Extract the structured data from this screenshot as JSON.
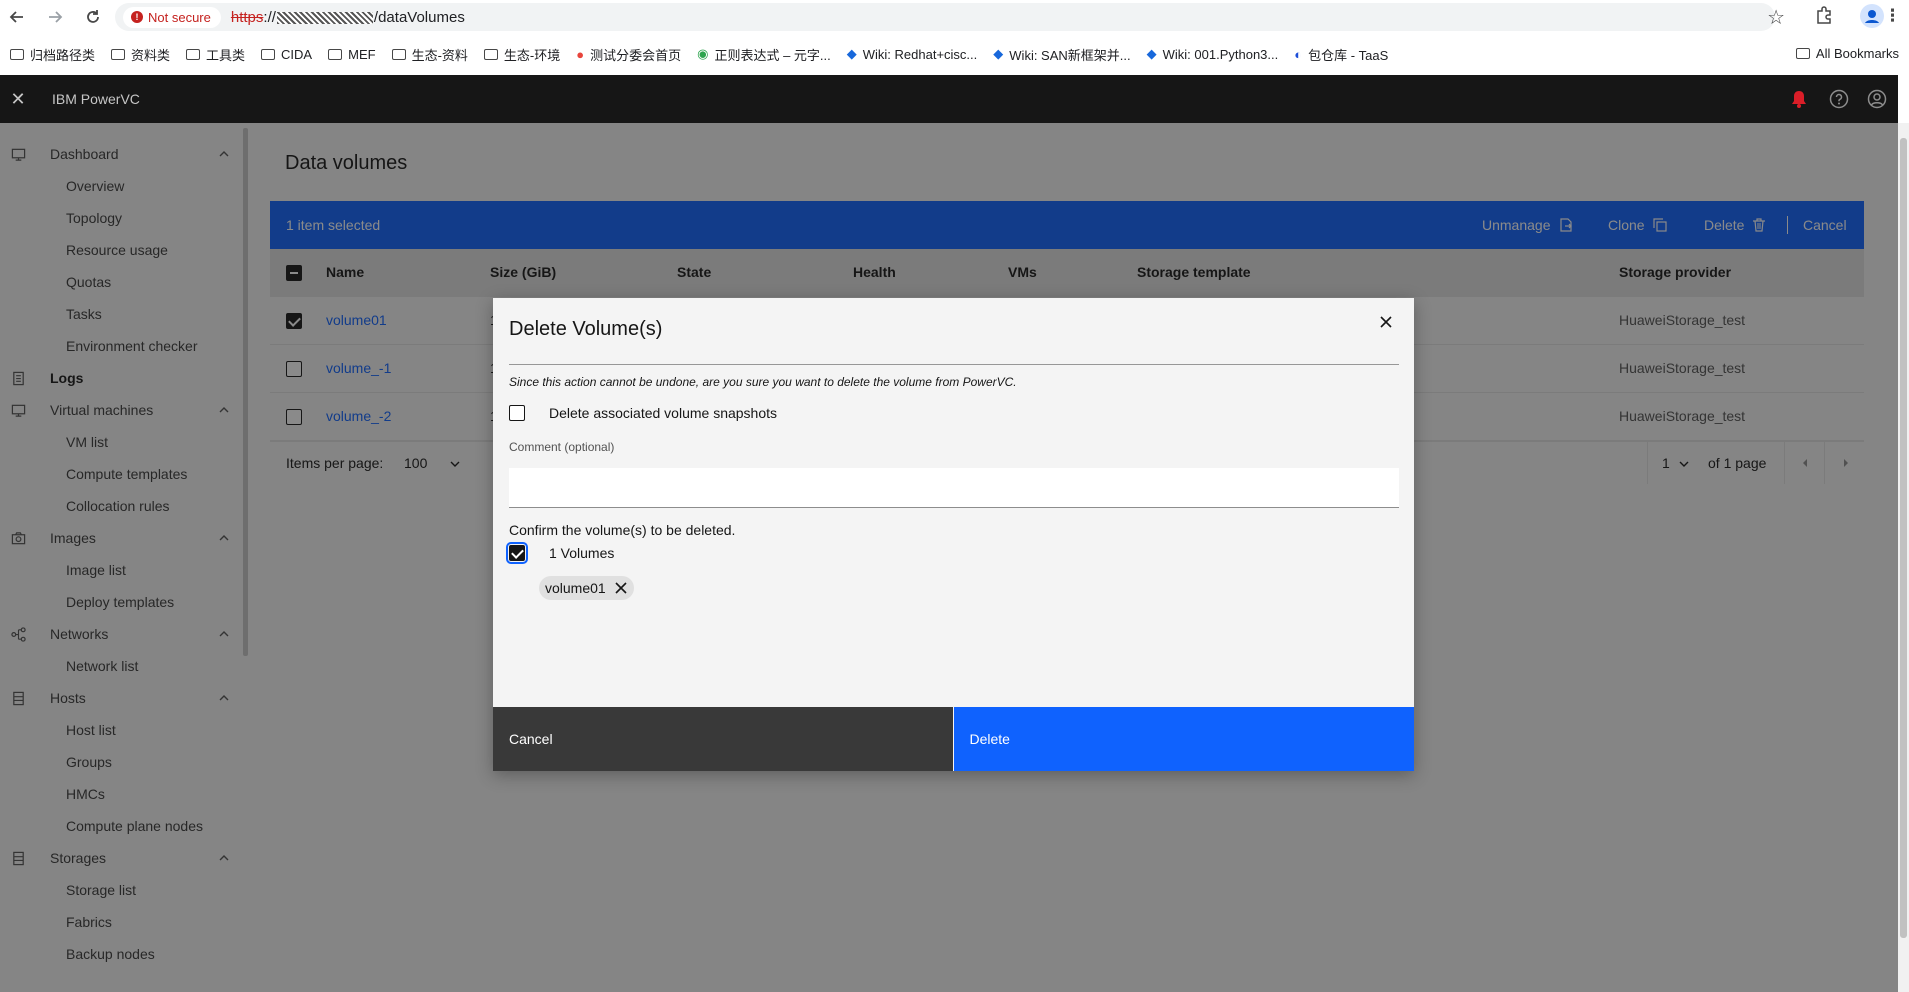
{
  "browser": {
    "security_label": "Not secure",
    "url_proto": "https",
    "url_sep": "://",
    "url_path": "/dataVolumes",
    "bookmarks": [
      "归档路径类",
      "资料类",
      "工具类",
      "CIDA",
      "MEF",
      "生态-资料",
      "生态-环境",
      "测试分委会首页",
      "正则表达式 – 元字...",
      "Wiki: Redhat+cisc...",
      "Wiki: SAN新框架并...",
      "Wiki: 001.Python3...",
      "包仓库 - TaaS"
    ],
    "all_bookmarks": "All Bookmarks"
  },
  "app": {
    "title": "IBM PowerVC"
  },
  "sidebar": {
    "items": [
      {
        "label": "Dashboard"
      },
      {
        "label": "Overview"
      },
      {
        "label": "Topology"
      },
      {
        "label": "Resource usage"
      },
      {
        "label": "Quotas"
      },
      {
        "label": "Tasks"
      },
      {
        "label": "Environment checker"
      },
      {
        "label": "Logs"
      },
      {
        "label": "Virtual machines"
      },
      {
        "label": "VM list"
      },
      {
        "label": "Compute templates"
      },
      {
        "label": "Collocation rules"
      },
      {
        "label": "Images"
      },
      {
        "label": "Image list"
      },
      {
        "label": "Deploy templates"
      },
      {
        "label": "Networks"
      },
      {
        "label": "Network list"
      },
      {
        "label": "Hosts"
      },
      {
        "label": "Host list"
      },
      {
        "label": "Groups"
      },
      {
        "label": "HMCs"
      },
      {
        "label": "Compute plane nodes"
      },
      {
        "label": "Storages"
      },
      {
        "label": "Storage list"
      },
      {
        "label": "Fabrics"
      },
      {
        "label": "Backup nodes"
      }
    ]
  },
  "page": {
    "title": "Data volumes",
    "selection": "1 item selected",
    "actions": {
      "unmanage": "Unmanage",
      "clone": "Clone",
      "delete": "Delete",
      "cancel": "Cancel"
    }
  },
  "table": {
    "headers": {
      "name": "Name",
      "size": "Size (GiB)",
      "state": "State",
      "health": "Health",
      "vms": "VMs",
      "template": "Storage template",
      "provider": "Storage provider"
    },
    "rows": [
      {
        "name": "volume01",
        "size": "1",
        "provider": "HuaweiStorage_test",
        "checked": true
      },
      {
        "name": "volume_-1",
        "size": "1",
        "provider": "HuaweiStorage_test",
        "checked": false
      },
      {
        "name": "volume_-2",
        "size": "1",
        "provider": "HuaweiStorage_test",
        "checked": false
      }
    ],
    "pager": {
      "items_label": "Items per page:",
      "per_page": "100",
      "page": "1",
      "of_pages": "of 1 page"
    }
  },
  "modal": {
    "title": "Delete Volume(s)",
    "warning": "Since this action cannot be undone, are you sure you want to delete the volume from PowerVC.",
    "snapshots_label": "Delete associated volume snapshots",
    "comment_label": "Comment (optional)",
    "comment_value": "",
    "confirm_text": "Confirm the volume(s) to be deleted.",
    "volumes_count_label": "1 Volumes",
    "tag": "volume01",
    "cancel": "Cancel",
    "delete": "Delete"
  },
  "colors": {
    "primary": "#0f62fe",
    "header_bg": "#161616",
    "alert": "#da1e28"
  }
}
